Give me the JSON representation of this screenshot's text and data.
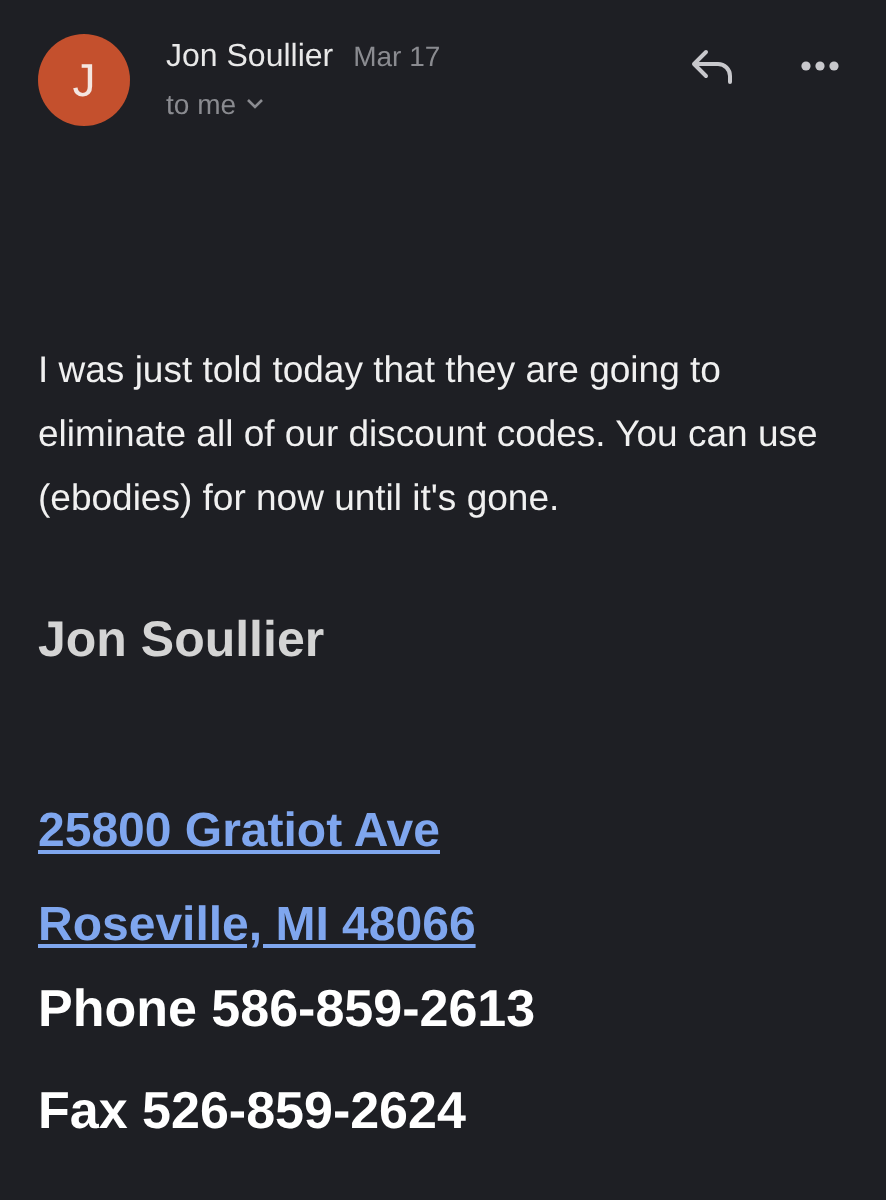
{
  "header": {
    "avatar_letter": "J",
    "sender": "Jon Soullier",
    "date": "Mar 17",
    "recipient": "to me"
  },
  "body": " I was just told today that they are going to eliminate all of our discount codes. You can use (ebodies) for now until it's gone.",
  "signature": {
    "name": "Jon Soullier",
    "address_links": [
      "25800 Gratiot Ave",
      "Roseville, MI 48066"
    ],
    "contact_lines": [
      "Phone 586-859-2613",
      "Fax 526-859-2624"
    ]
  }
}
